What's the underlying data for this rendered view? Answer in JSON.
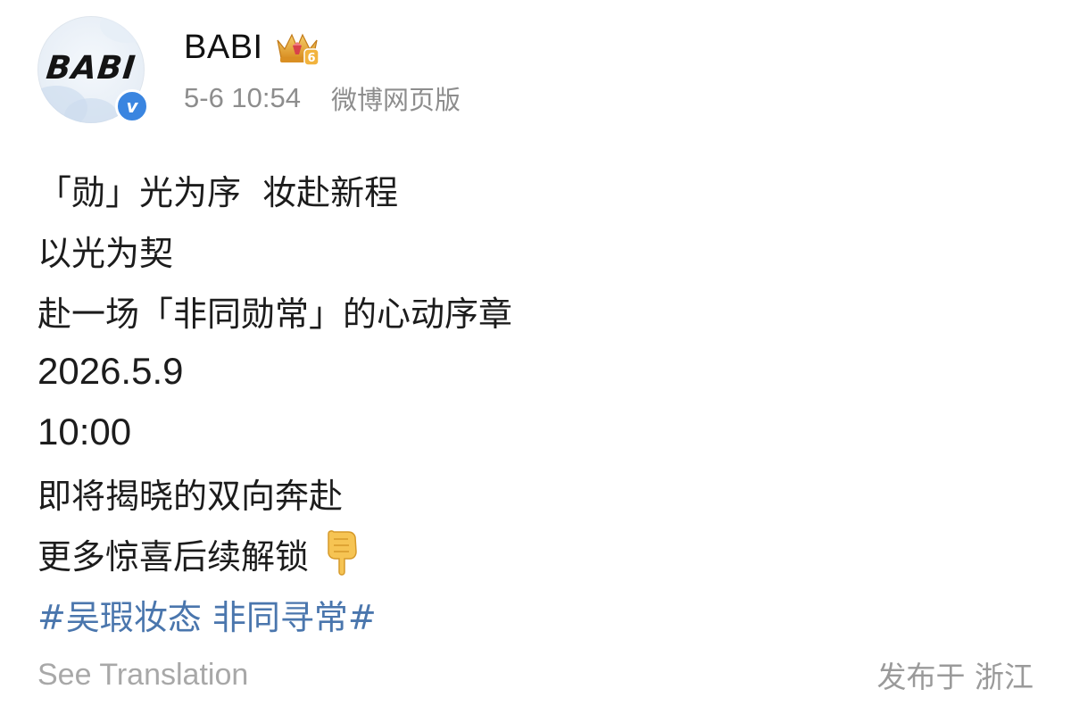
{
  "post": {
    "author": {
      "name": "BABI",
      "avatar_text": "BABI",
      "verified_badge": "v",
      "vip_badge_icon": "crown-level-badge",
      "vip_level": "6"
    },
    "timestamp": "5-6 10:54",
    "source": "微博网页版",
    "lines": [
      "「勋」光为序  妆赴新程",
      "以光为契",
      "赴一场「非同勋常」的心动序章",
      "2026.5.9",
      "10:00",
      "即将揭晓的双向奔赴",
      "更多惊喜后续解锁"
    ],
    "trailing_emoji": "pointing-down-hand-icon",
    "hashtag": "#吴瑕妆态 非同寻常#",
    "see_translation": "See Translation",
    "location": "发布于 浙江"
  },
  "colors": {
    "hashtag": "#4a76ad",
    "meta_gray": "#8d8d8d",
    "verified_blue": "#3a85e0",
    "crown_gold": "#e8a93a"
  }
}
